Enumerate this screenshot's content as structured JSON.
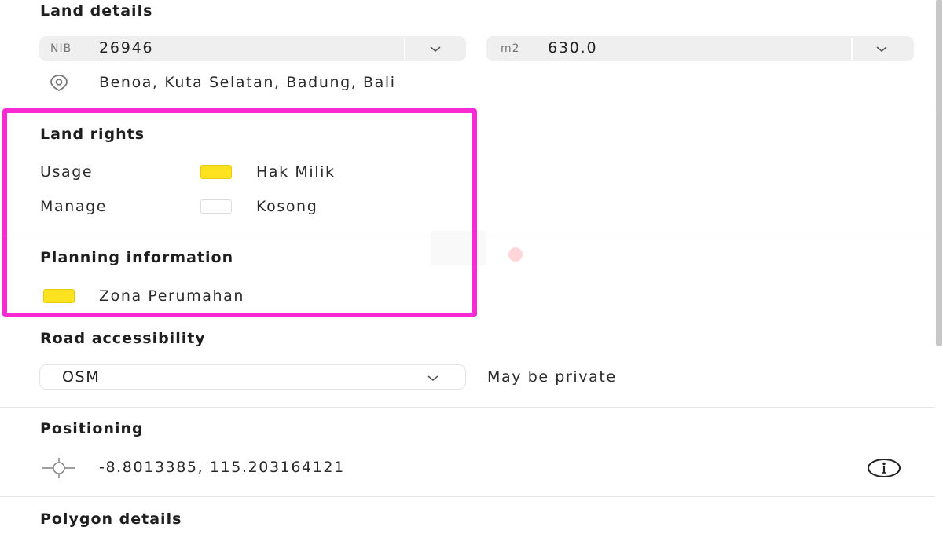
{
  "land_details": {
    "heading": "Land details",
    "nib": {
      "prefix": "NIB",
      "value": "26946"
    },
    "area": {
      "prefix": "m2",
      "value": "630.0"
    },
    "location_icon": "location-pin-icon",
    "address": "Benoa, Kuta Selatan, Badung, Bali"
  },
  "land_rights": {
    "heading": "Land rights",
    "rows": [
      {
        "label": "Usage",
        "value": "Hak Milik",
        "color": "#fde31f"
      },
      {
        "label": "Manage",
        "value": "Kosong",
        "color": "#ffffff"
      }
    ]
  },
  "planning_information": {
    "heading": "Planning information",
    "zone": {
      "label": "Zona Perumahan",
      "color": "#fde31f"
    }
  },
  "road_accessibility": {
    "heading": "Road accessibility",
    "source_selected": "OSM",
    "note": "May be private"
  },
  "positioning": {
    "heading": "Positioning",
    "icon": "crosshair-icon",
    "coordinates": "-8.8013385, 115.203164121",
    "info_icon": "info-icon"
  },
  "polygon_details": {
    "heading": "Polygon details"
  },
  "colors": {
    "highlight": "#f72ad3",
    "field_bg": "#efefef",
    "divider": "#e4e4e4"
  }
}
